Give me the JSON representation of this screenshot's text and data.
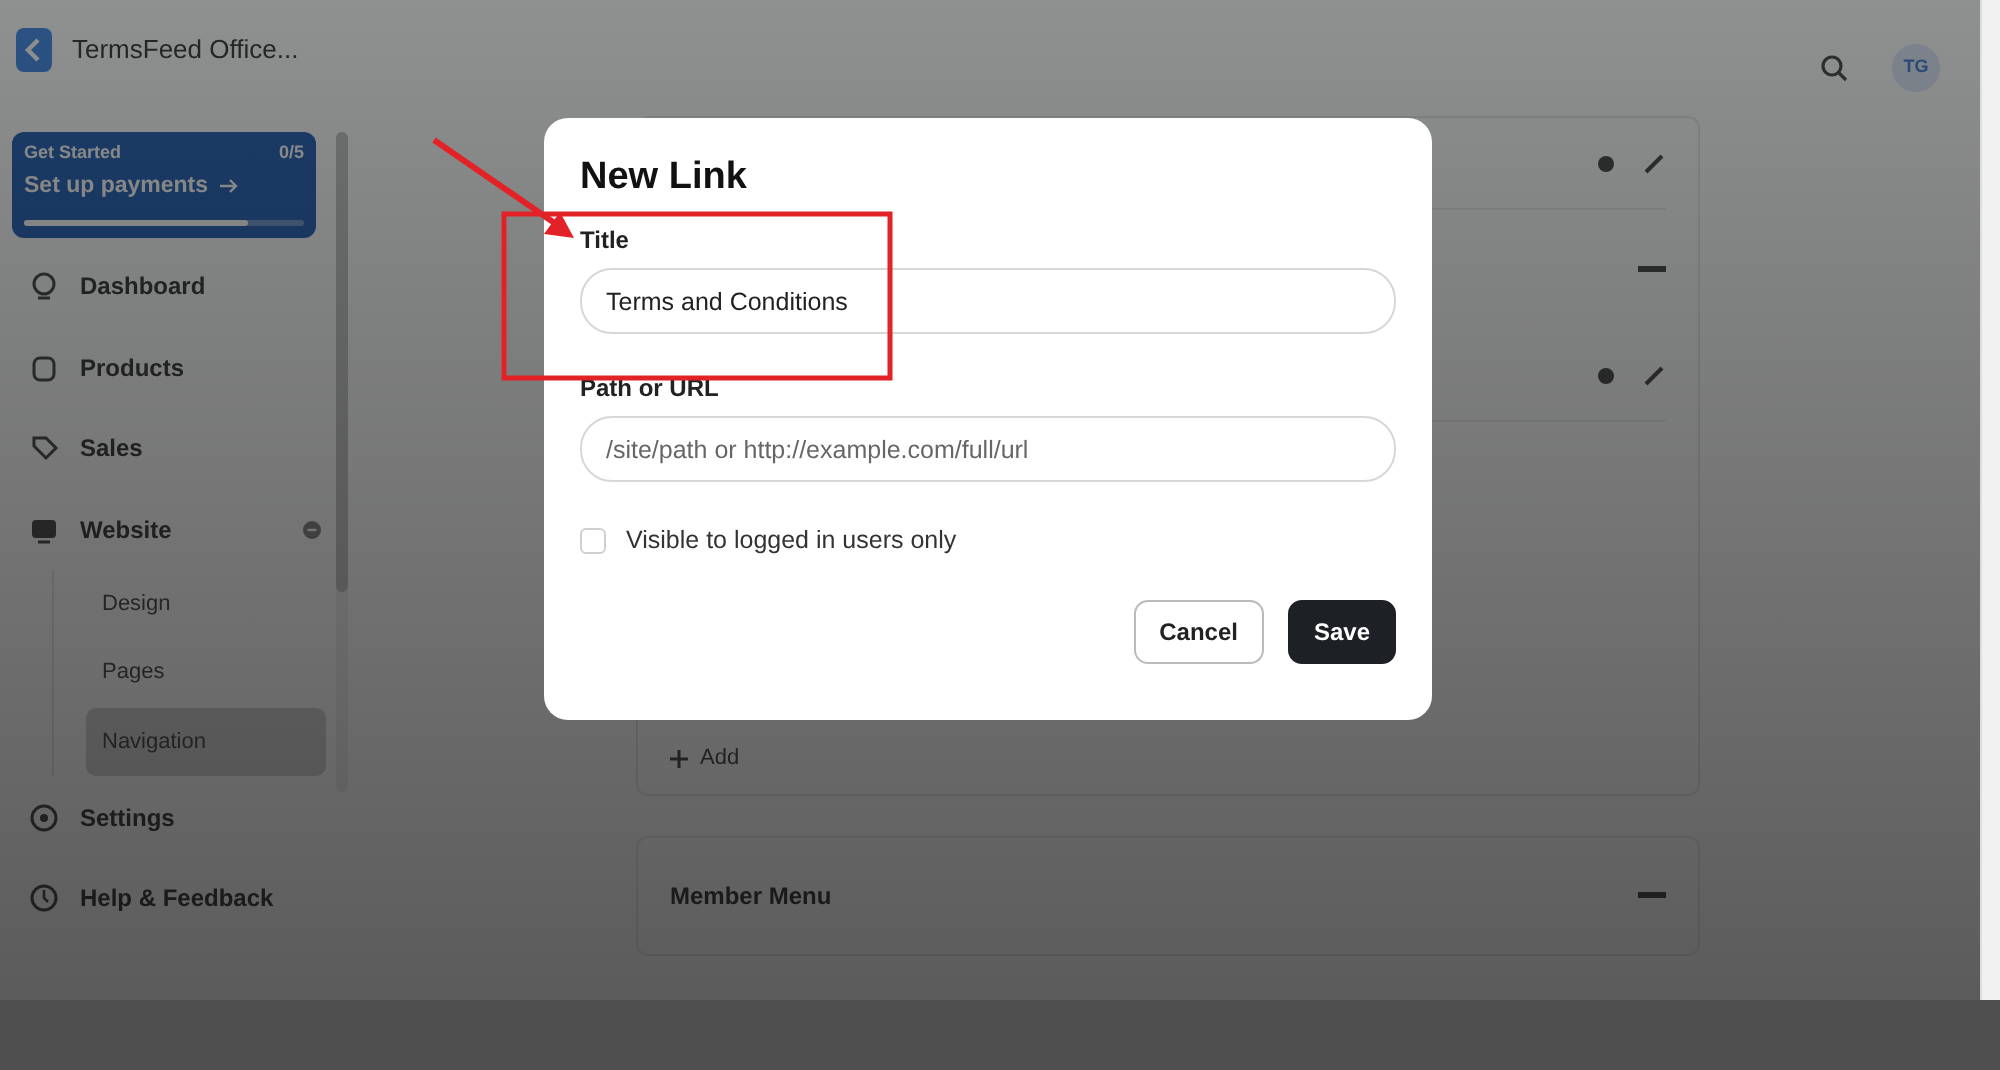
{
  "app": {
    "title": "TermsFeed Office..."
  },
  "onboarding": {
    "label": "Get Started",
    "count": "0/5",
    "task": "Set up payments",
    "level": 0.8
  },
  "sidebar": {
    "items": [
      {
        "label": "Dashboard",
        "kind": "dashboard",
        "selected": false
      },
      {
        "label": "Products",
        "kind": "products",
        "selected": false
      },
      {
        "label": "Sales",
        "kind": "sales",
        "selected": false
      },
      {
        "label": "Website",
        "kind": "website",
        "selected": false,
        "expanded": true,
        "children": [
          {
            "label": "Design",
            "selected": false
          },
          {
            "label": "Pages",
            "selected": false
          },
          {
            "label": "Navigation",
            "selected": true
          }
        ]
      },
      {
        "label": "Settings",
        "kind": "settings",
        "selected": false
      },
      {
        "label": "Help & Feedback",
        "kind": "help",
        "selected": false
      }
    ]
  },
  "user": {
    "initials": "TG"
  },
  "content": {
    "add_label": "Add",
    "menu_title": "Member Menu"
  },
  "dialog": {
    "title": "New Link",
    "fields": [
      {
        "label": "Title",
        "value": "Terms and Conditions"
      },
      {
        "label": "Path or URL",
        "placeholder": "/site/path or http://example.com/full/url"
      }
    ],
    "checkbox": {
      "label": "Visible to logged in users only",
      "checked": false
    },
    "buttons": [
      {
        "label": "Cancel",
        "kind": "secondary"
      },
      {
        "label": "Save",
        "kind": "primary"
      }
    ]
  }
}
